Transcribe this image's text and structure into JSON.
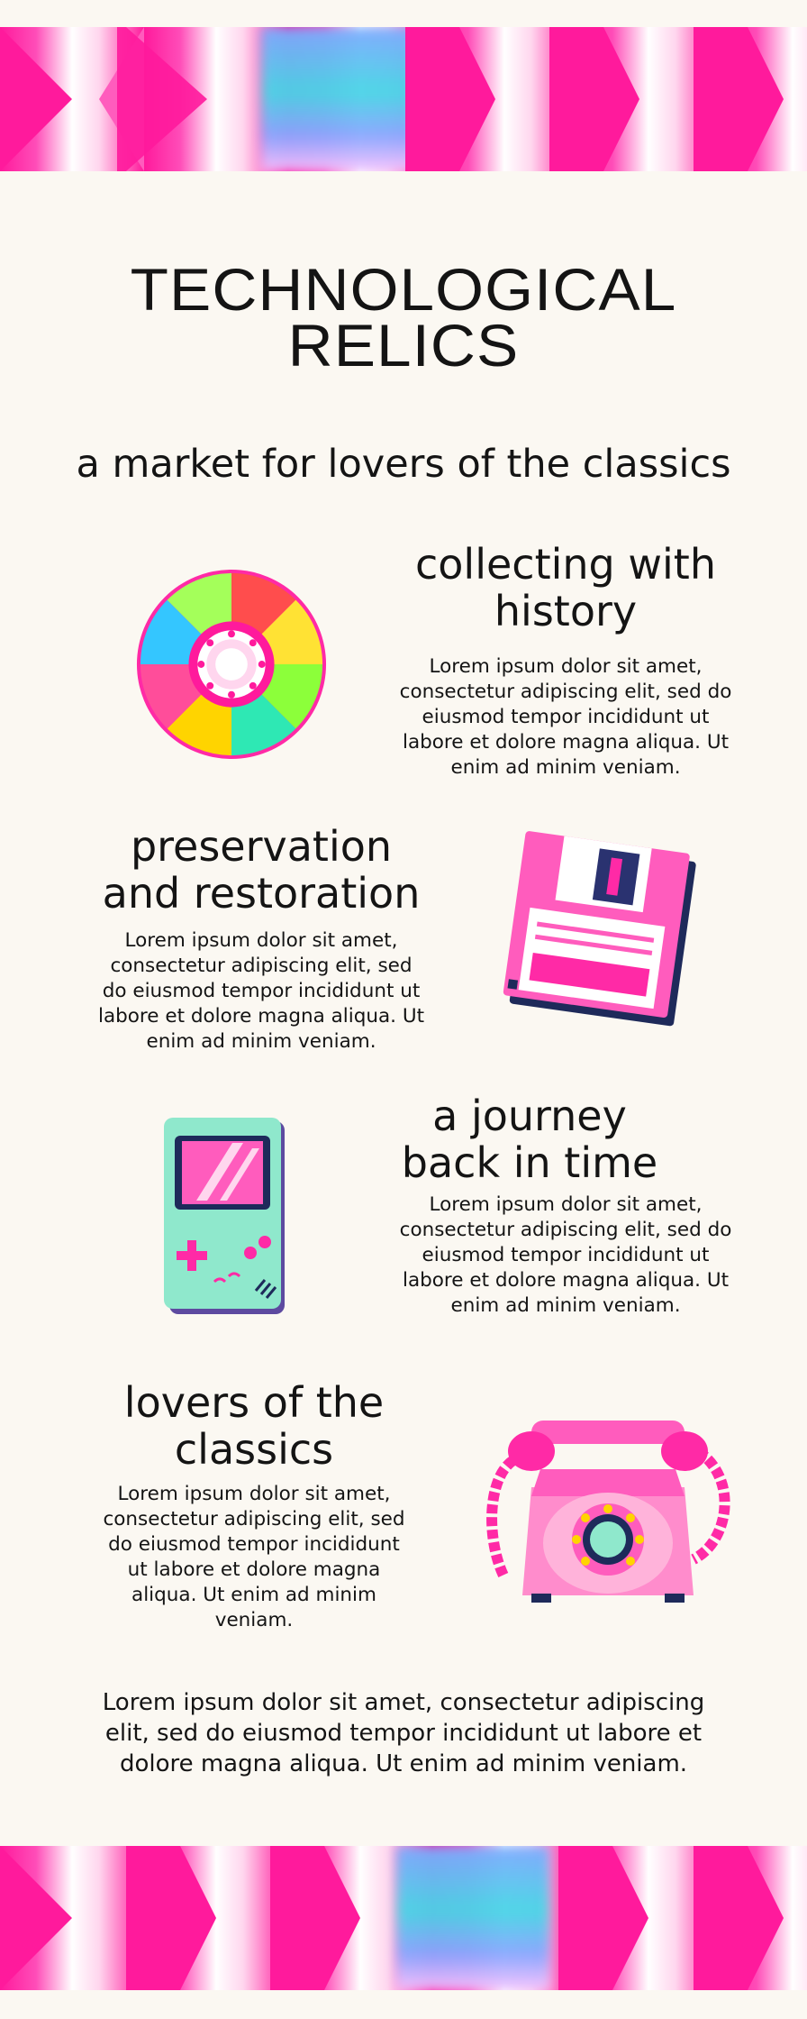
{
  "page": {
    "title_line1": "TECHNOLOGICAL",
    "title_line2": "RELICS",
    "subtitle": "a market for lovers of the classics"
  },
  "sections": [
    {
      "title": "collecting with history",
      "body": "Lorem ipsum dolor sit amet, consectetur adipiscing elit, sed do eiusmod tempor incididunt ut labore et dolore magna aliqua. Ut enim ad minim veniam.",
      "icon": "compact-disc-icon"
    },
    {
      "title": "preservation and restoration",
      "body": "Lorem ipsum dolor sit amet, consectetur adipiscing elit, sed do eiusmod tempor incididunt ut labore et dolore magna aliqua. Ut enim ad minim veniam.",
      "icon": "floppy-disk-icon"
    },
    {
      "title": "a journey back in time",
      "body": "Lorem ipsum dolor sit amet, consectetur adipiscing elit, sed do eiusmod tempor incididunt ut labore et dolore magna aliqua. Ut enim ad minim veniam.",
      "icon": "handheld-console-icon"
    },
    {
      "title": "lovers of the classics",
      "body": "Lorem ipsum dolor sit amet, consectetur adipiscing elit, sed do eiusmod tempor incididunt ut labore et dolore magna aliqua. Ut enim ad minim veniam.",
      "icon": "rotary-telephone-icon"
    }
  ],
  "footer": {
    "text": "Lorem ipsum dolor sit amet, consectetur adipiscing elit, sed do eiusmod tempor incididunt ut labore et dolore magna aliqua. Ut enim ad minim veniam."
  },
  "colors": {
    "background": "#fbf8f2",
    "accent_pink": "#ff1a9c",
    "accent_mint": "#8fe8cc",
    "text": "#141414"
  }
}
